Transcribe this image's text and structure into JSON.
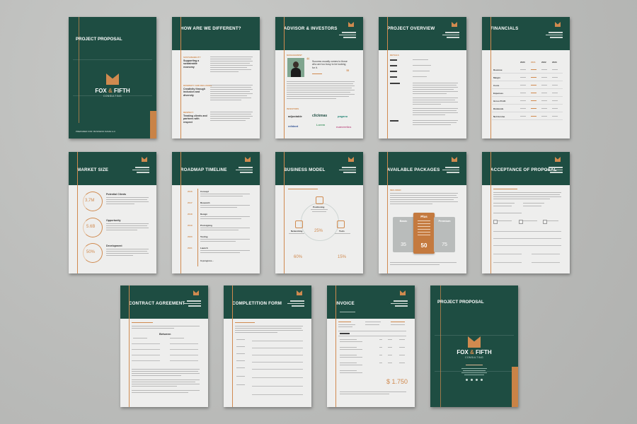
{
  "pages": [
    {
      "title": "PROJECT PROPOSAL",
      "brand_left": "FOX",
      "brand_amp": "&",
      "brand_right": "FIFTH",
      "brand_sub": "CONSULTING",
      "footer": "PREPARED FOR: BUSINESS NAME LLC"
    },
    {
      "title": "HOW ARE WE DIFFERENT?",
      "items": [
        "Supporting a sustainable economy",
        "Creativity through inclusion and diversity",
        "Treating clients and partners with respect"
      ]
    },
    {
      "title": "ADVISOR & INVESTORS",
      "quote": "Success usually comes to those who are too busy to be looking for it.",
      "logos": [
        "adjustable",
        "clickmas",
        "paganu",
        "edidant",
        "Lorem",
        "numeretics"
      ]
    },
    {
      "title": "PROJECT OVERVIEW"
    },
    {
      "title": "FINANCIALS",
      "columns": [
        "2020",
        "2021",
        "2022",
        "2023"
      ],
      "rows": [
        "Revenue",
        "Margin",
        "Costs",
        "Expenses",
        "Gross Profit",
        "Dividends",
        "Net Income"
      ]
    },
    {
      "title": "MARKET SIZE",
      "stats": [
        {
          "value": "3,7M",
          "label": "Potential Clients"
        },
        {
          "value": "5.6B",
          "label": "Opportunity"
        },
        {
          "value": "50%",
          "label": "Development"
        }
      ]
    },
    {
      "title": "ROADMAP TIMELINE",
      "years": [
        "2016",
        "2017",
        "2018",
        "2019",
        "2020",
        "2021"
      ],
      "steps": [
        "Concept",
        "Research",
        "Design",
        "Prototyping",
        "Testing",
        "Launch",
        "In progress..."
      ]
    },
    {
      "title": "BUSINESS MODEL",
      "nodes": [
        "Positioning",
        "Networking",
        "Tools"
      ],
      "percents": [
        "25%",
        "60%",
        "15%"
      ]
    },
    {
      "title": "AVAILABLE PACKAGES",
      "packages": [
        {
          "name": "Basic",
          "price": "35"
        },
        {
          "name": "Plus",
          "price": "50"
        },
        {
          "name": "Premium",
          "price": "75"
        }
      ]
    },
    {
      "title": "ACCEPTANCE OF PROPOSAL"
    },
    {
      "title": "CONTRACT AGREEMENT",
      "between": "Between"
    },
    {
      "title": "COMPLETITION FORM"
    },
    {
      "title": "INVOICE",
      "total": "$ 1.750"
    },
    {
      "title": "PROJECT PROPOSAL",
      "brand_left": "FOX",
      "brand_amp": "&",
      "brand_right": "FIFTH",
      "brand_sub": "CONSULTING"
    }
  ],
  "colors": {
    "green": "#1e4d42",
    "orange": "#d08a4f",
    "background": "#bcbdbb"
  }
}
